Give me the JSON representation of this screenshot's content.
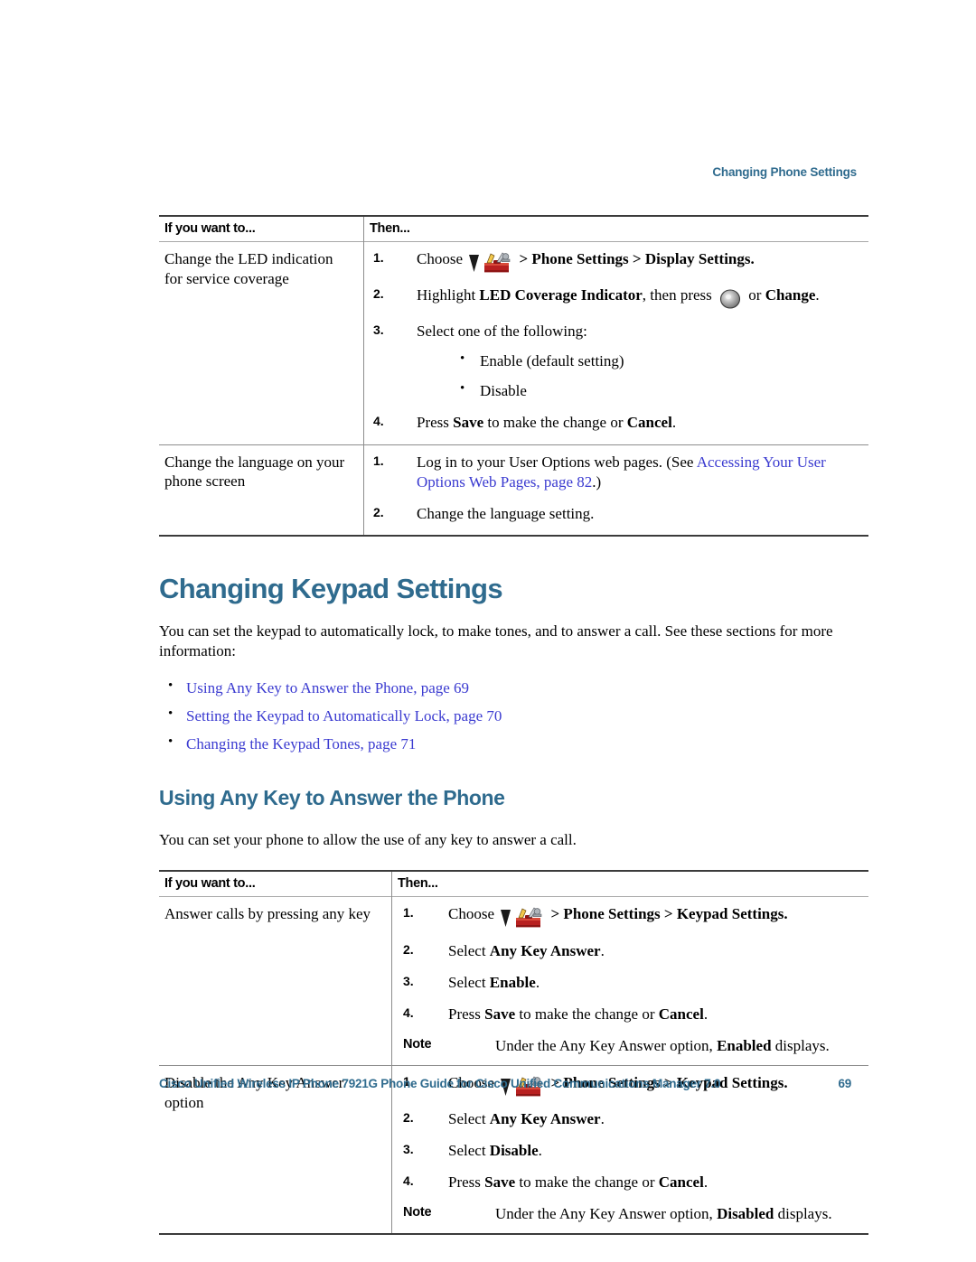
{
  "header": {
    "running_title": "Changing Phone Settings",
    "accent_color": "#2f6b8e"
  },
  "footer": {
    "guide_title": "Cisco Unified Wireless IP Phone 7921G Phone Guide for Cisco Unified Communications Manager 7.0",
    "page_number": "69"
  },
  "colors": {
    "heading": "#2f6b8e",
    "link": "#3a3ad0",
    "rule_dark": "#3b3b3b",
    "rule_light": "#8d8d8d"
  },
  "table_display": {
    "headers": {
      "if_you_want_to": "If you want to...",
      "then": "Then..."
    },
    "rows": [
      {
        "want_to": "Change the LED indication for service coverage",
        "steps": [
          {
            "num": "1.",
            "parts": [
              {
                "text": "Choose ",
                "style": "normal"
              },
              {
                "icon": "nav-arrow-down-icon"
              },
              {
                "icon": "settings-toolbox-icon"
              },
              {
                "text": " > Phone Settings > Display Settings.",
                "style": "bold"
              }
            ]
          },
          {
            "num": "2.",
            "parts": [
              {
                "text": "Highlight ",
                "style": "normal"
              },
              {
                "text": "LED Coverage Indicator",
                "style": "bold"
              },
              {
                "text": ", then press ",
                "style": "normal"
              },
              {
                "icon": "select-button-icon"
              },
              {
                "text": " or ",
                "style": "normal"
              },
              {
                "text": "Change",
                "style": "bold"
              },
              {
                "text": ".",
                "style": "normal"
              }
            ]
          },
          {
            "num": "3.",
            "parts": [
              {
                "text": "Select one of the following:",
                "style": "normal"
              }
            ],
            "bullets": [
              "Enable (default setting)",
              "Disable"
            ]
          },
          {
            "num": "4.",
            "parts": [
              {
                "text": "Press ",
                "style": "normal"
              },
              {
                "text": "Save",
                "style": "bold"
              },
              {
                "text": " to make the change or ",
                "style": "normal"
              },
              {
                "text": "Cancel",
                "style": "bold"
              },
              {
                "text": ".",
                "style": "normal"
              }
            ]
          }
        ]
      },
      {
        "want_to": "Change the language on your phone screen",
        "steps": [
          {
            "num": "1.",
            "parts": [
              {
                "text": "Log in to your User Options web pages. (See ",
                "style": "normal"
              },
              {
                "text": "Accessing Your User Options Web Pages, page 82",
                "style": "link"
              },
              {
                "text": ".)",
                "style": "normal"
              }
            ]
          },
          {
            "num": "2.",
            "parts": [
              {
                "text": "Change the language setting.",
                "style": "normal"
              }
            ]
          }
        ]
      }
    ]
  },
  "section_keypad": {
    "title": "Changing Keypad Settings",
    "intro": "You can set the keypad to automatically lock, to make tones, and to answer a call. See these sections for more information:",
    "links": [
      "Using Any Key to Answer the Phone, page 69",
      "Setting the Keypad to Automatically Lock, page 70",
      "Changing the Keypad Tones, page 71"
    ]
  },
  "section_anykey": {
    "title": "Using Any Key to Answer the Phone",
    "intro": "You can set your phone to allow the use of any key to answer a call."
  },
  "table_anykey": {
    "headers": {
      "if_you_want_to": "If you want to...",
      "then": "Then..."
    },
    "rows": [
      {
        "want_to": "Answer calls by pressing any key",
        "steps": [
          {
            "num": "1.",
            "parts": [
              {
                "text": "Choose ",
                "style": "normal"
              },
              {
                "icon": "nav-arrow-down-icon"
              },
              {
                "icon": "settings-toolbox-icon"
              },
              {
                "text": " > Phone Settings > Keypad Settings.",
                "style": "bold"
              }
            ]
          },
          {
            "num": "2.",
            "parts": [
              {
                "text": "Select ",
                "style": "normal"
              },
              {
                "text": "Any Key Answer",
                "style": "bold"
              },
              {
                "text": ".",
                "style": "normal"
              }
            ]
          },
          {
            "num": "3.",
            "parts": [
              {
                "text": "Select ",
                "style": "normal"
              },
              {
                "text": "Enable",
                "style": "bold"
              },
              {
                "text": ".",
                "style": "normal"
              }
            ]
          },
          {
            "num": "4.",
            "parts": [
              {
                "text": "Press ",
                "style": "normal"
              },
              {
                "text": "Save",
                "style": "bold"
              },
              {
                "text": " to make the change or ",
                "style": "normal"
              },
              {
                "text": "Cancel",
                "style": "bold"
              },
              {
                "text": ".",
                "style": "normal"
              }
            ]
          }
        ],
        "note": {
          "label": "Note",
          "parts": [
            {
              "text": "Under the Any Key Answer option, ",
              "style": "normal"
            },
            {
              "text": "Enabled",
              "style": "bold"
            },
            {
              "text": " displays.",
              "style": "normal"
            }
          ]
        }
      },
      {
        "want_to": "Disable the Any Key Answer option",
        "steps": [
          {
            "num": "1.",
            "parts": [
              {
                "text": "Choose ",
                "style": "normal"
              },
              {
                "icon": "nav-arrow-down-icon"
              },
              {
                "icon": "settings-toolbox-icon"
              },
              {
                "text": " > Phone Settings > Keypad Settings.",
                "style": "bold"
              }
            ]
          },
          {
            "num": "2.",
            "parts": [
              {
                "text": "Select ",
                "style": "normal"
              },
              {
                "text": "Any Key Answer",
                "style": "bold"
              },
              {
                "text": ".",
                "style": "normal"
              }
            ]
          },
          {
            "num": "3.",
            "parts": [
              {
                "text": "Select ",
                "style": "normal"
              },
              {
                "text": "Disable",
                "style": "bold"
              },
              {
                "text": ".",
                "style": "normal"
              }
            ]
          },
          {
            "num": "4.",
            "parts": [
              {
                "text": "Press ",
                "style": "normal"
              },
              {
                "text": "Save",
                "style": "bold"
              },
              {
                "text": " to make the change or ",
                "style": "normal"
              },
              {
                "text": "Cancel",
                "style": "bold"
              },
              {
                "text": ".",
                "style": "normal"
              }
            ]
          }
        ],
        "note": {
          "label": "Note",
          "parts": [
            {
              "text": "Under the Any Key Answer option, ",
              "style": "normal"
            },
            {
              "text": "Disabled",
              "style": "bold"
            },
            {
              "text": " displays.",
              "style": "normal"
            }
          ]
        }
      }
    ]
  }
}
